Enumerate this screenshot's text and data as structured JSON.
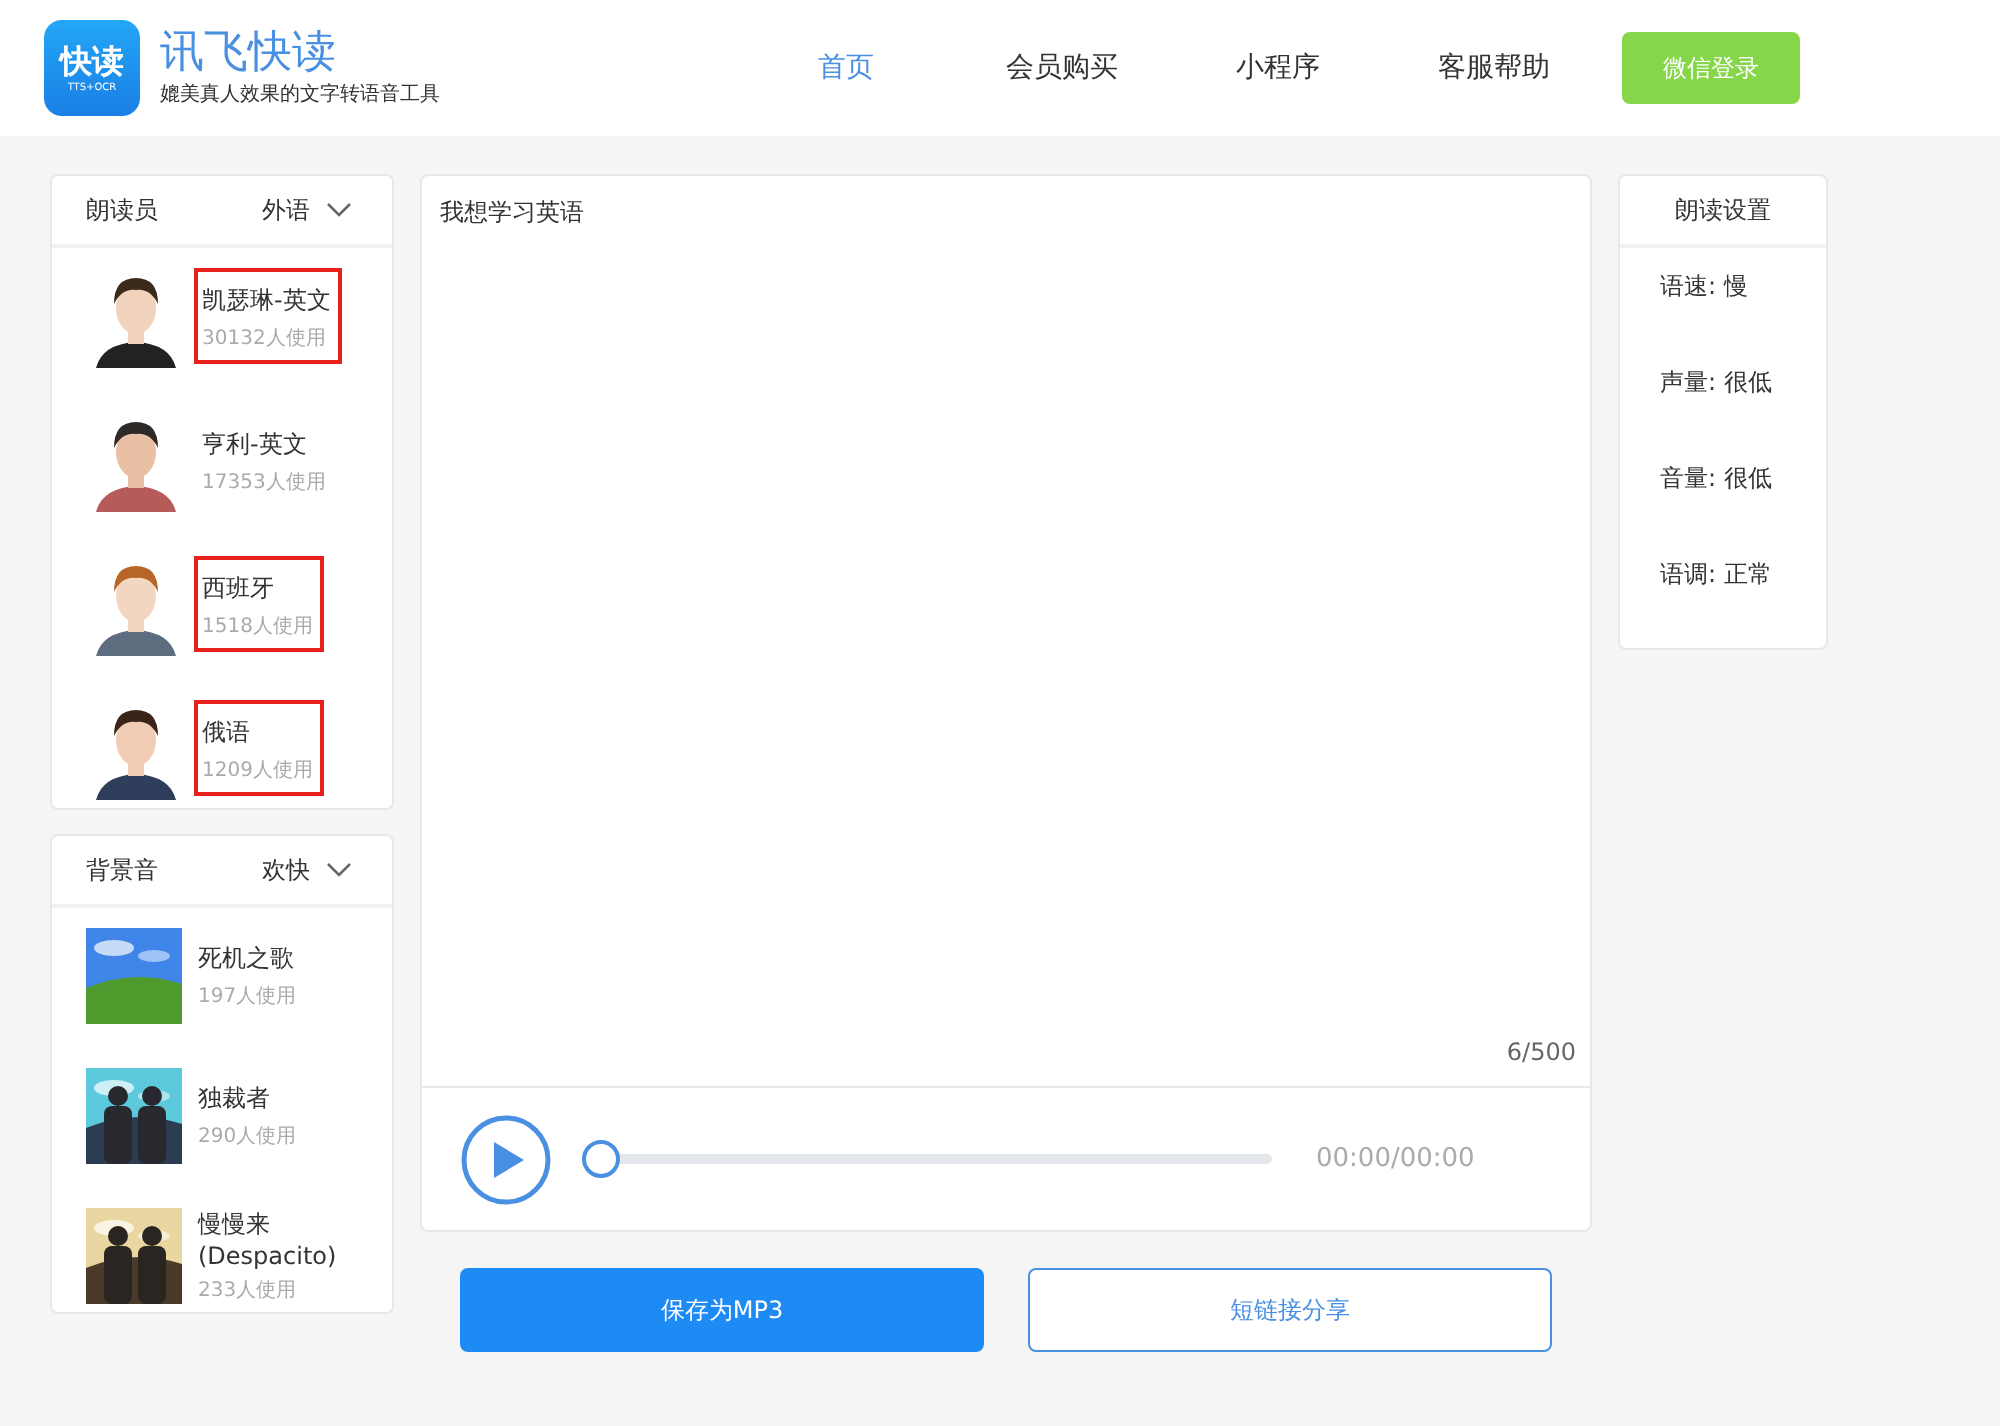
{
  "header": {
    "logo_text": "快读",
    "logo_sub": "TTS+OCR",
    "title": "讯飞快读",
    "subtitle": "媲美真人效果的文字转语音工具",
    "nav": [
      {
        "label": "首页",
        "selected": true
      },
      {
        "label": "会员购买",
        "selected": false
      },
      {
        "label": "小程序",
        "selected": false
      },
      {
        "label": "客服帮助",
        "selected": false
      }
    ],
    "login_button": "微信登录"
  },
  "voices": {
    "title": "朗读员",
    "filter": "外语",
    "items": [
      {
        "name": "凯瑟琳-英文",
        "usage": "30132人使用",
        "highlighted": true
      },
      {
        "name": "亨利-英文",
        "usage": "17353人使用",
        "highlighted": false
      },
      {
        "name": "西班牙",
        "usage": "1518人使用",
        "highlighted": true
      },
      {
        "name": "俄语",
        "usage": "1209人使用",
        "highlighted": true
      }
    ]
  },
  "music": {
    "title": "背景音",
    "filter": "欢快",
    "items": [
      {
        "name": "死机之歌",
        "usage": "197人使用"
      },
      {
        "name": "独裁者",
        "usage": "290人使用"
      },
      {
        "name": "慢慢来 (Despacito)",
        "usage": "233人使用"
      }
    ]
  },
  "editor": {
    "text": "我想学习英语",
    "counter": "6/500"
  },
  "player": {
    "level": 0,
    "time": "00:00/00:00"
  },
  "actions": {
    "save": "保存为MP3",
    "share": "短链接分享"
  },
  "settings": {
    "title": "朗读设置",
    "items": [
      "语速: 慢",
      "声量: 很低",
      "音量: 很低",
      "语调: 正常"
    ]
  }
}
